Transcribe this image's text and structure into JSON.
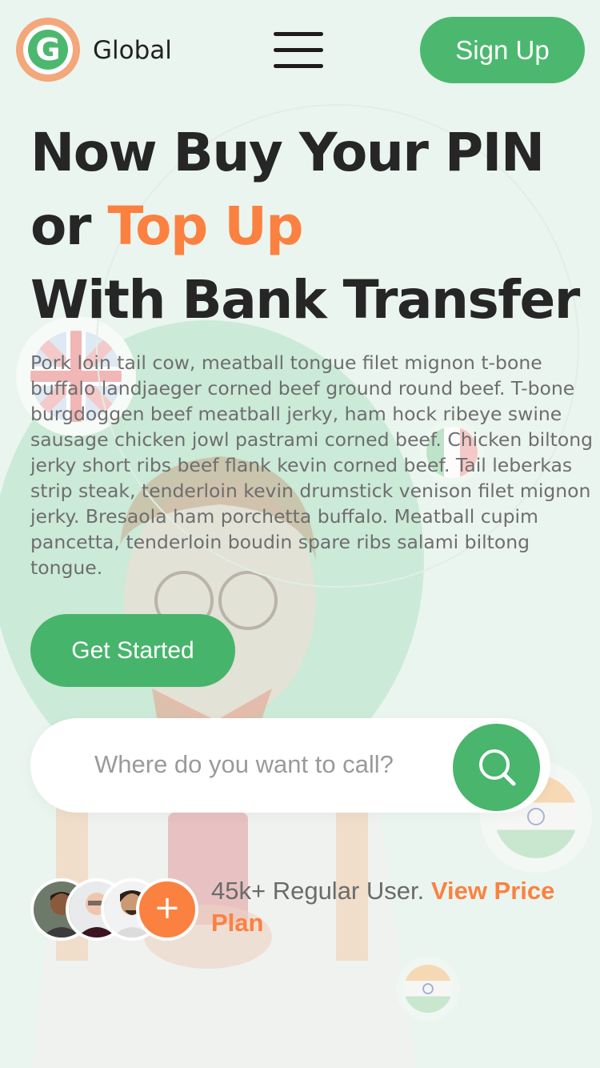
{
  "header": {
    "logo_letter": "G",
    "brand": "Global",
    "signup_label": "Sign Up"
  },
  "hero": {
    "line1": "Now Buy Your PIN",
    "line2_prefix": "or ",
    "line2_accent": "Top Up",
    "line3": "With Bank Transfer",
    "paragraph": "Pork loin tail cow, meatball tongue filet mignon t-bone buffalo landjaeger corned beef ground round beef. T-bone burgdoggen beef meatball jerky, ham hock ribeye swine sausage chicken jowl pastrami corned beef. Chicken biltong jerky short ribs beef flank kevin corned beef. Tail leberkas strip steak, tenderloin kevin drumstick venison filet mignon jerky. Bresaola ham porchetta buffalo. Meatball cupim pancetta, tenderloin boudin spare ribs salami biltong tongue.",
    "cta_label": "Get Started"
  },
  "search": {
    "placeholder": "Where do you want to call?",
    "icon": "search-icon"
  },
  "social_proof": {
    "count_text": "45k+ Regular User. ",
    "link_text": "View Price Plan",
    "plus_symbol": "+"
  },
  "colors": {
    "brand_green": "#4cb86f",
    "accent_orange": "#fb8141",
    "background": "#eaf5ef",
    "heading": "#262626"
  }
}
